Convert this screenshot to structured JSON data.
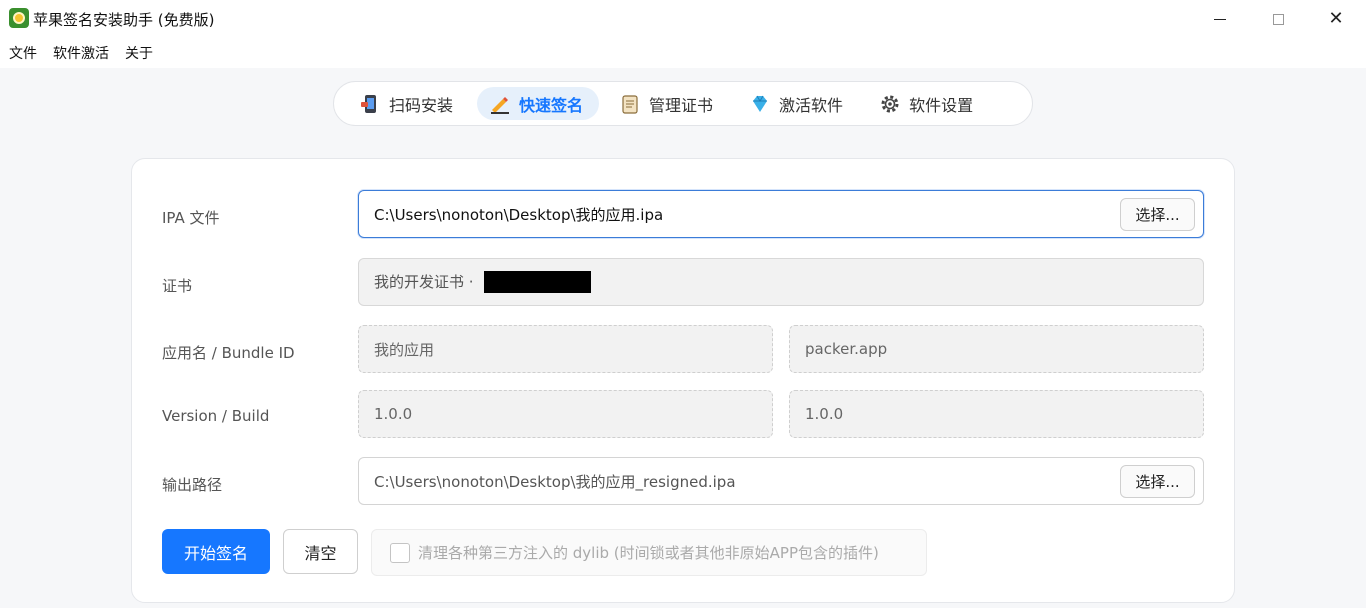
{
  "window": {
    "title": "苹果签名安装助手 (免费版)"
  },
  "menu": {
    "items": [
      "文件",
      "软件激活",
      "关于"
    ]
  },
  "tabs": [
    {
      "label": "扫码安装",
      "icon": "phone-scan-icon",
      "active": false
    },
    {
      "label": "快速签名",
      "icon": "pen-sign-icon",
      "active": true
    },
    {
      "label": "管理证书",
      "icon": "scroll-certificate-icon",
      "active": false
    },
    {
      "label": "激活软件",
      "icon": "diamond-icon",
      "active": false
    },
    {
      "label": "软件设置",
      "icon": "gear-icon",
      "active": false
    }
  ],
  "form": {
    "ipa": {
      "label": "IPA 文件",
      "value": "C:\\Users\\nonoton\\Desktop\\我的应用.ipa",
      "button": "选择..."
    },
    "cert": {
      "label": "证书",
      "value": "我的开发证书 · "
    },
    "appname": {
      "label": "应用名 / Bundle ID",
      "name": "我的应用",
      "bundle": "packer.app"
    },
    "version": {
      "label": "Version / Build",
      "version": "1.0.0",
      "build": "1.0.0"
    },
    "output": {
      "label": "输出路径",
      "value": "C:\\Users\\nonoton\\Desktop\\我的应用_resigned.ipa",
      "button": "选择..."
    }
  },
  "actions": {
    "start": "开始签名",
    "clear": "清空",
    "dylib_option": "清理各种第三方注入的 dylib (时间锁或者其他非原始APP包含的插件)",
    "dylib_checked": false
  },
  "colors": {
    "accent": "#1677ff",
    "active_tab_bg": "#e6f0fb"
  }
}
